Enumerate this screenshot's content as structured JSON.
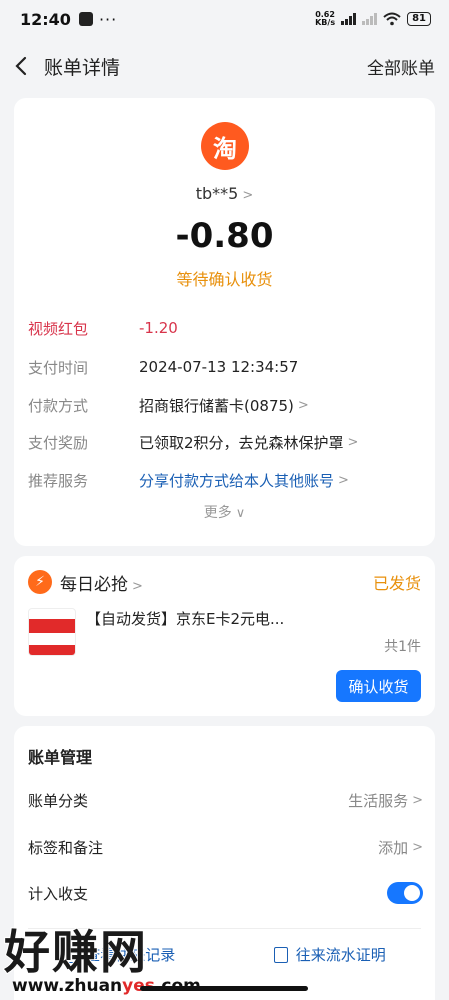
{
  "status_bar": {
    "time": "12:40",
    "net_speed_value": "0.62",
    "net_speed_unit": "KB/s",
    "battery": "81"
  },
  "nav": {
    "title": "账单详情",
    "right_link": "全部账单"
  },
  "bill": {
    "merchant_logo_char": "淘",
    "merchant_name": "tb**5",
    "amount": "-0.80",
    "status": "等待确认收货",
    "rows": [
      {
        "label": "视频红包",
        "value": "-1.20"
      },
      {
        "label": "支付时间",
        "value": "2024-07-13 12:34:57"
      },
      {
        "label": "付款方式",
        "value": "招商银行储蓄卡(0875)"
      },
      {
        "label": "支付奖励",
        "value": "已领取2积分，去兑森林保护罩"
      },
      {
        "label": "推荐服务",
        "value": "分享付款方式给本人其他账号"
      }
    ],
    "more": "更多"
  },
  "daily": {
    "title": "每日必抢",
    "status": "已发货",
    "product_title": "【自动发货】京东E卡2元电...",
    "quantity": "共1件",
    "confirm_button": "确认收货"
  },
  "management": {
    "title": "账单管理",
    "rows": [
      {
        "label": "账单分类",
        "value": "生活服务"
      },
      {
        "label": "标签和备注",
        "value": "添加"
      },
      {
        "label": "计入收支",
        "value": ""
      }
    ],
    "include_in_budget": true,
    "links": [
      "查看往来记录",
      "往来流水证明"
    ]
  },
  "watermark": {
    "text": "好赚网",
    "url_prefix": "www.zhuan",
    "url_highlight": "yes",
    "url_suffix": ".com"
  },
  "colors": {
    "accent": "#1677ff",
    "warning": "#e8900c",
    "danger": "#d8344b",
    "link": "#1a5fb4"
  }
}
